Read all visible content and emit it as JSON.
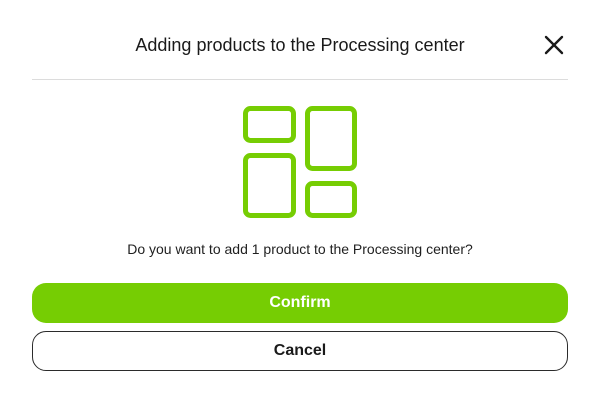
{
  "dialog": {
    "title": "Adding products to the Processing center",
    "close_icon": "close-icon",
    "hero_icon": "dashboard-tiles-icon",
    "message": "Do you want to add 1 product to the Processing center?",
    "confirm_label": "Confirm",
    "cancel_label": "Cancel"
  },
  "colors": {
    "accent": "#76cd03",
    "text": "#1a1a1a",
    "divider": "#dcdcdc",
    "background": "#ffffff"
  }
}
